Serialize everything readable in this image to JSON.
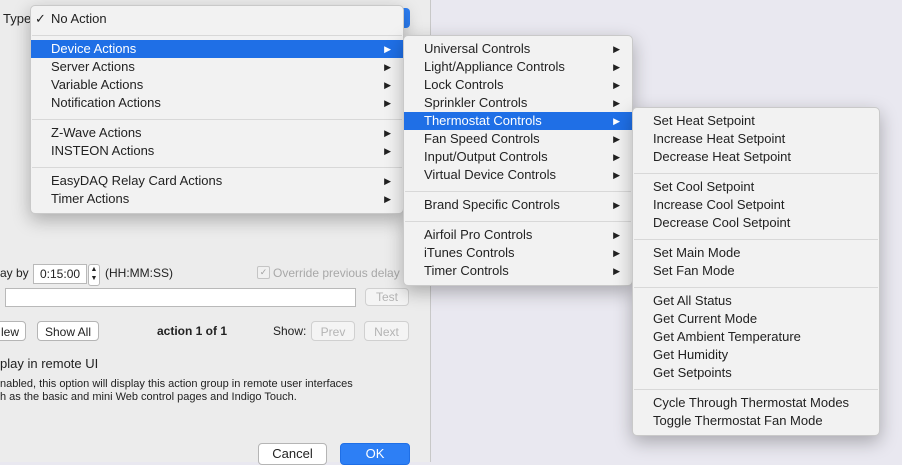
{
  "dialog": {
    "type_label": "Type",
    "delay_label": "ay by",
    "delay_value": "0:15:00",
    "delay_format": "(HH:MM:SS)",
    "override_label": "Override previous delay",
    "test_button": "Test",
    "new_button": "lew",
    "show_all_button": "Show All",
    "action_counter": "action 1 of 1",
    "show_label": "Show:",
    "prev_button": "Prev",
    "next_button": "Next",
    "remote_ui_label": "play in remote UI",
    "remote_ui_desc_1": "nabled, this option will display this action group in remote user interfaces",
    "remote_ui_desc_2": "h as the basic and mini Web control pages and Indigo Touch.",
    "cancel_button": "Cancel",
    "ok_button": "OK"
  },
  "menu1": {
    "checkmark": "✓",
    "items": [
      "No Action",
      "Device Actions",
      "Server Actions",
      "Variable Actions",
      "Notification Actions",
      "Z-Wave Actions",
      "INSTEON Actions",
      "EasyDAQ Relay Card Actions",
      "Timer Actions"
    ]
  },
  "menu2": {
    "items": [
      "Universal Controls",
      "Light/Appliance Controls",
      "Lock Controls",
      "Sprinkler Controls",
      "Thermostat Controls",
      "Fan Speed Controls",
      "Input/Output Controls",
      "Virtual Device Controls",
      "Brand Specific Controls",
      "Airfoil Pro Controls",
      "iTunes Controls",
      "Timer Controls"
    ]
  },
  "menu3": {
    "items": [
      "Set Heat Setpoint",
      "Increase Heat Setpoint",
      "Decrease Heat Setpoint",
      "Set Cool Setpoint",
      "Increase Cool Setpoint",
      "Decrease Cool Setpoint",
      "Set Main Mode",
      "Set Fan Mode",
      "Get All Status",
      "Get Current Mode",
      "Get Ambient Temperature",
      "Get Humidity",
      "Get Setpoints",
      "Cycle Through Thermostat Modes",
      "Toggle Thermostat Fan Mode"
    ]
  },
  "colors": {
    "highlight": "#1f6fe6",
    "ok_button": "#2d7ff5"
  },
  "icons": {
    "submenu": "submenu-arrow-icon",
    "check": "checkmark-icon"
  }
}
